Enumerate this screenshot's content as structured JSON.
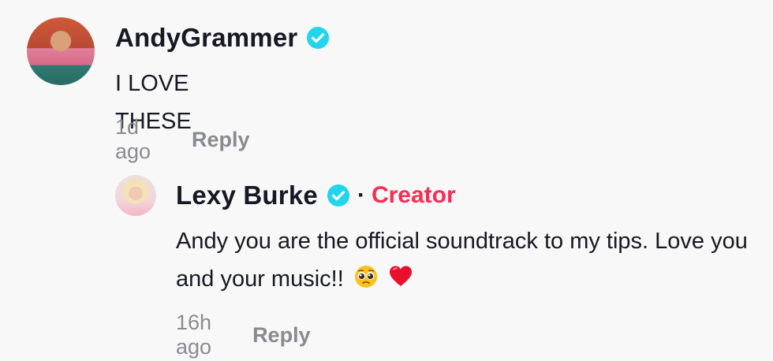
{
  "comments": [
    {
      "username": "AndyGrammer",
      "verified": true,
      "text": "I LOVE THESE",
      "time": "1d ago",
      "reply_label": "Reply"
    },
    {
      "username": "Lexy Burke",
      "verified": true,
      "badge": "Creator",
      "separator": "·",
      "text": "Andy you are the official soundtrack to my tips. Love you and your music!!",
      "emojis": [
        "pleading-face-emoji",
        "red-heart-emoji"
      ],
      "time": "16h ago",
      "reply_label": "Reply"
    }
  ],
  "colors": {
    "background": "#f8f8f8",
    "text": "#161823",
    "muted": "#8a8b91",
    "verified": "#20d5ec",
    "creator": "#fe2c55"
  }
}
